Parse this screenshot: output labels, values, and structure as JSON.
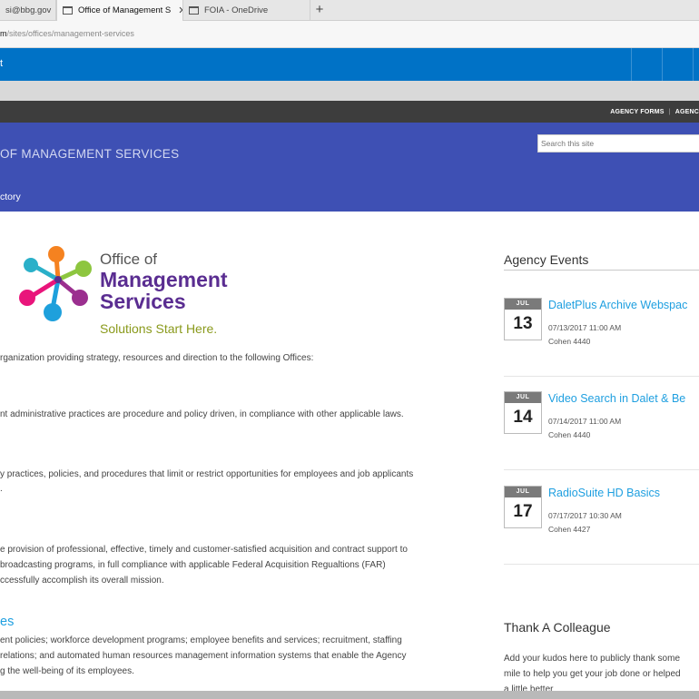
{
  "browser": {
    "tabs": [
      {
        "label": "si@bbg.gov"
      },
      {
        "label": "Office of Management S"
      },
      {
        "label": "FOIA - OneDrive"
      }
    ],
    "close_glyph": "✕",
    "new_tab_glyph": "+",
    "url_domain": "m",
    "url_path": "/sites/offices/management-services"
  },
  "suitebar": {
    "glyph": "t"
  },
  "top_links": {
    "agency_forms": "AGENCY FORMS",
    "divider": "|",
    "agency_more": "AGENC"
  },
  "header": {
    "site_title": "OF MANAGEMENT SERVICES",
    "search_placeholder": "Search this site",
    "nav_item": "ctory"
  },
  "logo": {
    "line1": "Office of",
    "line2": "Management",
    "line3": "Services",
    "tagline": "Solutions Start Here."
  },
  "main": {
    "intro": "rganization providing strategy, resources and direction to the following Offices:",
    "p1": "nt administrative practices are procedure and policy driven, in compliance with other applicable laws.",
    "p2_l1": "y practices, policies, and procedures that limit or restrict opportunities for employees and job applicants",
    "p2_l2": ".",
    "p3_l1": "e provision of professional, effective, timely and customer-satisfied acquisition and contract support to",
    "p3_l2": "broadcasting programs, in full compliance with applicable Federal Acquisition Regualtions (FAR)",
    "p3_l3": "ccessfully accomplish its overall mission.",
    "subhead": "es",
    "p4_l1": "ent policies; workforce development programs; employee benefits and services; recruitment, staffing",
    "p4_l2": "relations; and automated human resources management information systems that enable the Agency",
    "p4_l3": "g the well-being of its employees."
  },
  "events": {
    "title": "Agency Events",
    "items": [
      {
        "month": "JUL",
        "day": "13",
        "title": "DaletPlus Archive Webspac",
        "datetime": "07/13/2017 11:00 AM",
        "location": "Cohen 4440"
      },
      {
        "month": "JUL",
        "day": "14",
        "title": "Video Search in Dalet & Be",
        "datetime": "07/14/2017 11:00 AM",
        "location": "Cohen 4440"
      },
      {
        "month": "JUL",
        "day": "17",
        "title": "RadioSuite HD Basics",
        "datetime": "07/17/2017 10:30 AM",
        "location": "Cohen 4427"
      }
    ]
  },
  "kudos": {
    "title": "Thank A Colleague",
    "line1": "Add your kudos here to publicly thank some",
    "line2": "mile to help you get your job done or helped",
    "line3": "a little better"
  },
  "colors": {
    "suitebar": "#0072c6",
    "header": "#3e50b4",
    "topbar": "#3d3d3d",
    "link": "#1e9fe0",
    "logo_purple": "#5a2d91",
    "tagline": "#8a9a1c"
  }
}
